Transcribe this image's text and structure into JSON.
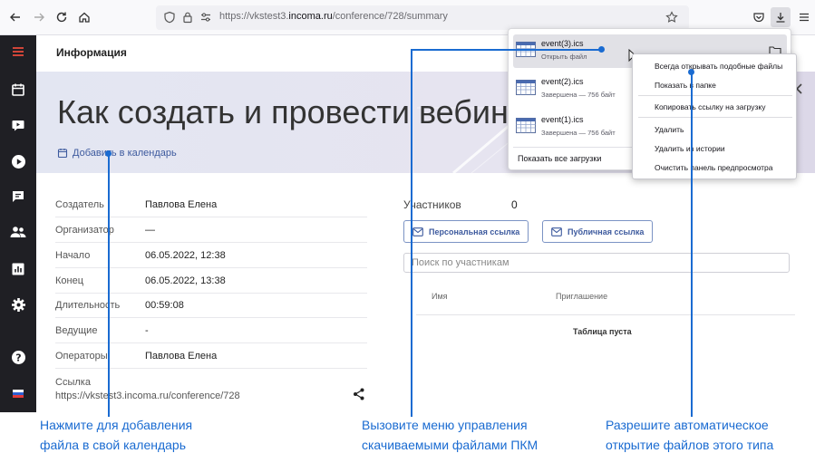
{
  "browser": {
    "url_prefix": "https://vkstest3.",
    "url_domain": "incoma.ru",
    "url_path": "/conference/728/summary"
  },
  "sidebar": {
    "items": [
      "menu-icon",
      "calendar-icon",
      "video-icon",
      "play-icon",
      "chat-icon",
      "users-icon",
      "stats-icon",
      "gear-icon",
      "help-icon",
      "flag-icon"
    ]
  },
  "header": {
    "title": "Информация"
  },
  "hero": {
    "title": "Как создать и провести вебин",
    "add_to_calendar": "Добавить в календарь"
  },
  "info": {
    "rows": [
      {
        "label": "Создатель",
        "value": "Павлова Елена"
      },
      {
        "label": "Организатор",
        "value": "—"
      },
      {
        "label": "Начало",
        "value": "06.05.2022, 12:38"
      },
      {
        "label": "Конец",
        "value": "06.05.2022, 13:38"
      },
      {
        "label": "Длительность",
        "value": "00:59:08"
      },
      {
        "label": "Ведущие",
        "value": "-"
      },
      {
        "label": "Операторы",
        "value": "Павлова Елена"
      }
    ],
    "link_label": "Ссылка",
    "link_value": "https://vkstest3.incoma.ru/conference/728"
  },
  "participants": {
    "label": "Участников",
    "count": "0",
    "personal_link": "Персональная ссылка",
    "public_link": "Публичная ссылка",
    "search_placeholder": "Поиск по участникам",
    "col_name": "Имя",
    "col_invite": "Приглашение",
    "empty": "Таблица пуста"
  },
  "downloads": {
    "items": [
      {
        "name": "event(3).ics",
        "status": "Открыть файл"
      },
      {
        "name": "event(2).ics",
        "status": "Завершена — 756 байт"
      },
      {
        "name": "event(1).ics",
        "status": "Завершена — 756 байт"
      }
    ],
    "show_all": "Показать все загрузки"
  },
  "context_menu": {
    "always_open": "Всегда открывать подобные файлы",
    "show_in_folder": "Показать в папке",
    "copy_link": "Копировать ссылку на загрузку",
    "delete": "Удалить",
    "delete_history": "Удалить из истории",
    "clear_panel": "Очистить панель предпросмотра"
  },
  "annotations": {
    "calendar_line1": "Нажмите для добавления",
    "calendar_line2": "файла в свой календарь",
    "menu_line1": "Вызовите меню управления",
    "menu_line2": "скачиваемыми файлами ПКМ",
    "auto_line1": "Разрешите автоматическое",
    "auto_line2": "открытие файлов этого типа"
  },
  "colors": {
    "annotation": "#1a6bd1",
    "sidebar": "#1f1f24",
    "brand_red": "#e94b3c",
    "link_blue": "#3d5a9e"
  }
}
